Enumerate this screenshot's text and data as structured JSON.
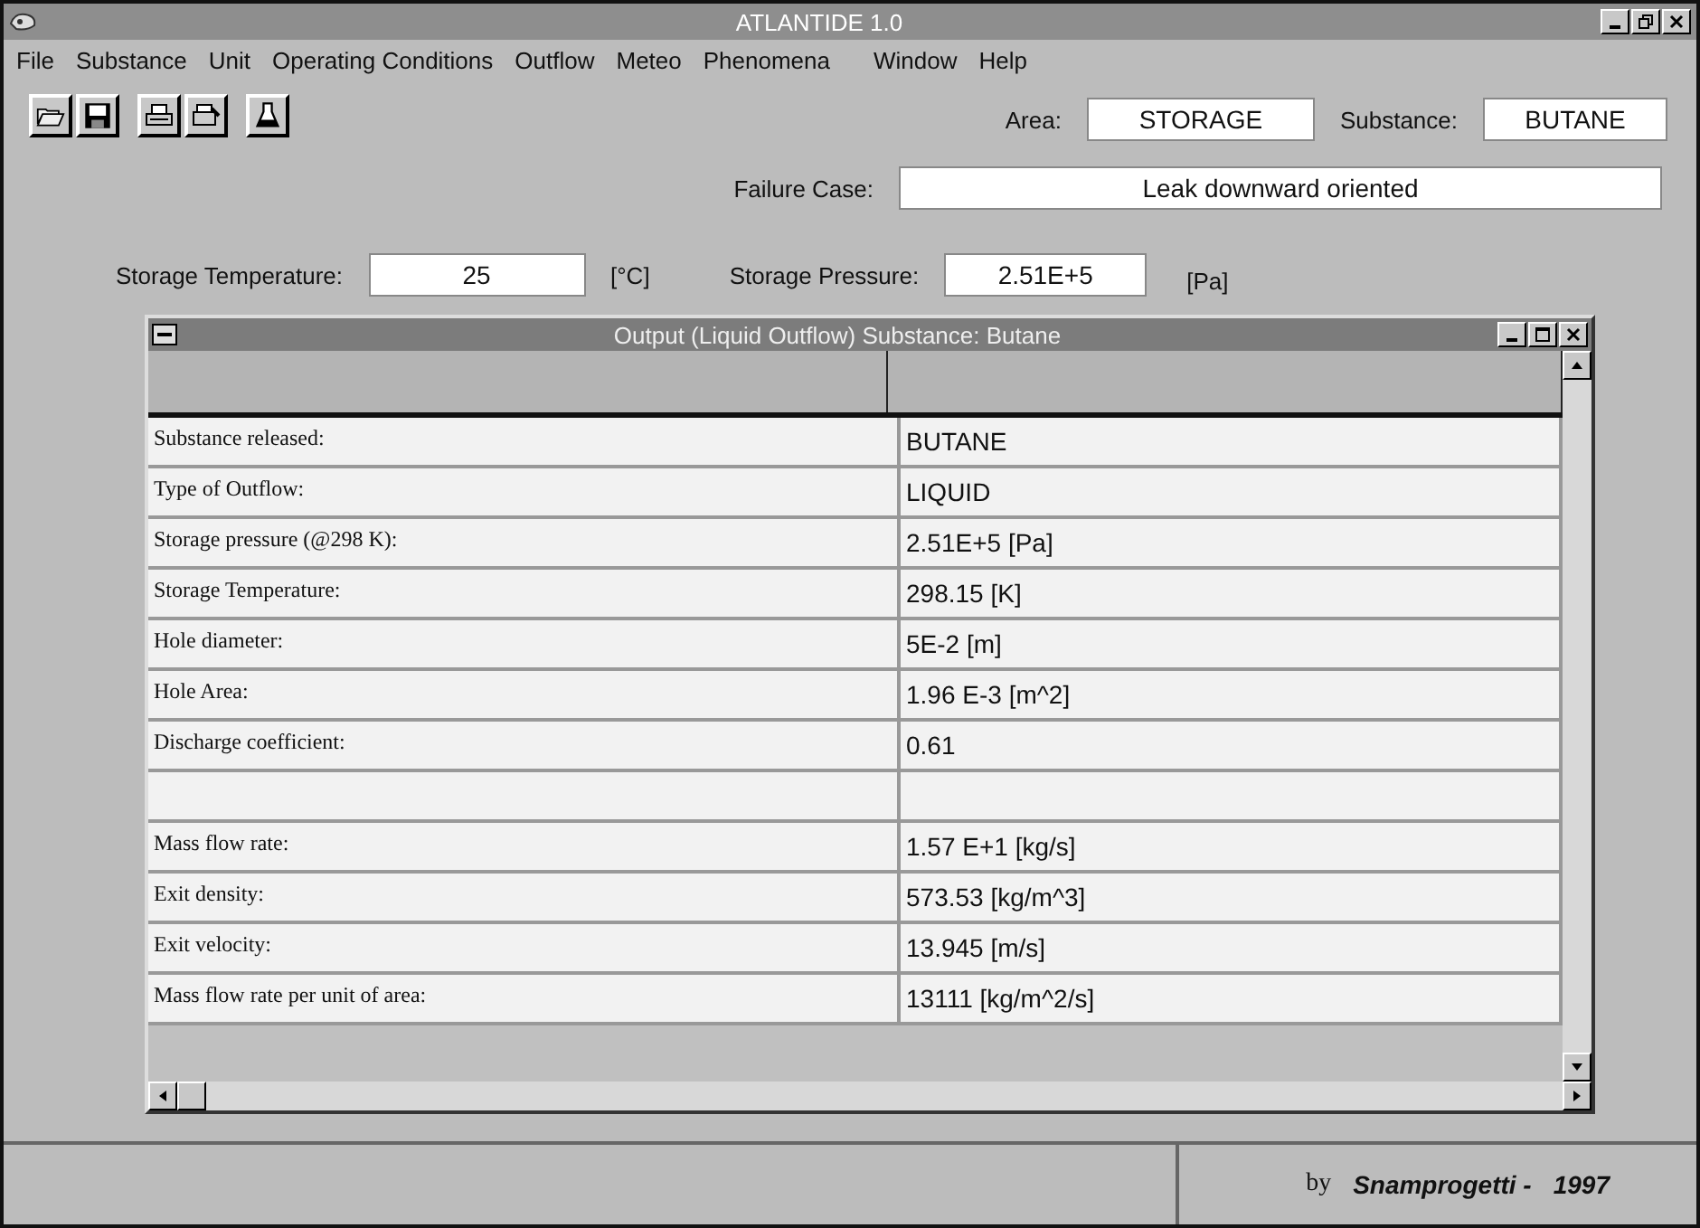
{
  "window": {
    "title": "ATLANTIDE 1.0"
  },
  "menu": [
    "File",
    "Substance",
    "Unit",
    "Operating Conditions",
    "Outflow",
    "Meteo",
    "Phenomena",
    "Window",
    "Help"
  ],
  "area": {
    "label": "Area:",
    "value": "STORAGE"
  },
  "substance": {
    "label": "Substance:",
    "value": "BUTANE"
  },
  "failure_case": {
    "label": "Failure Case:",
    "value": "Leak downward oriented"
  },
  "storage_temperature": {
    "label": "Storage Temperature:",
    "value": "25",
    "unit": "[°C]"
  },
  "storage_pressure": {
    "label": "Storage Pressure:",
    "value": "2.51E+5",
    "unit": "[Pa]"
  },
  "output_window": {
    "title": "Output (Liquid Outflow) Substance: Butane",
    "rows": [
      {
        "kind": "data",
        "label": "Substance released:",
        "value": "BUTANE"
      },
      {
        "kind": "data",
        "label": "Type of Outflow:",
        "value": "LIQUID"
      },
      {
        "kind": "data",
        "label": "Storage pressure (@298 K):",
        "value": "2.51E+5 [Pa]"
      },
      {
        "kind": "data",
        "label": "Storage Temperature:",
        "value": "298.15 [K]"
      },
      {
        "kind": "data",
        "label": "Hole diameter:",
        "value": "5E-2 [m]"
      },
      {
        "kind": "data",
        "label": "Hole Area:",
        "value": "1.96 E-3 [m^2]"
      },
      {
        "kind": "data",
        "label": "Discharge coefficient:",
        "value": "0.61"
      },
      {
        "kind": "blank"
      },
      {
        "kind": "data",
        "label": "Mass flow rate:",
        "value": "1.57 E+1 [kg/s]"
      },
      {
        "kind": "data",
        "label": "Exit density:",
        "value": "573.53 [kg/m^3]"
      },
      {
        "kind": "data",
        "label": "Exit velocity:",
        "value": "13.945 [m/s]"
      },
      {
        "kind": "data",
        "label": "Mass flow rate per unit of area:",
        "value": "13111 [kg/m^2/s]"
      }
    ]
  },
  "status_bar": {
    "by": "by",
    "company": "Snamprogetti -",
    "year": "1997"
  }
}
